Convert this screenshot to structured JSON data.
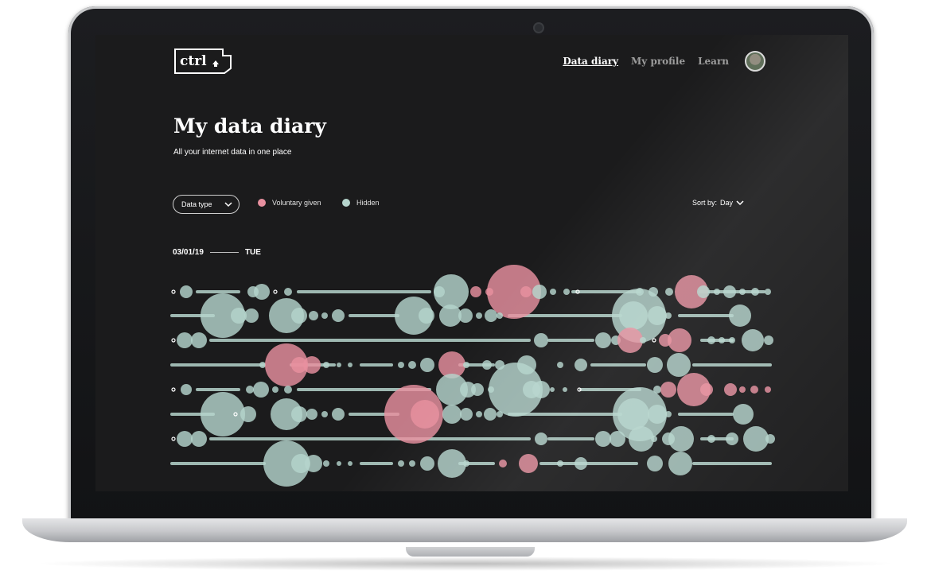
{
  "app": {
    "logo_text": "ctrl",
    "nav": [
      {
        "label": "Data diary",
        "active": true
      },
      {
        "label": "My profile",
        "active": false
      },
      {
        "label": "Learn",
        "active": false
      }
    ]
  },
  "page": {
    "title": "My data diary",
    "subtitle": "All your internet data in one place"
  },
  "filters": {
    "data_type_label": "Data type",
    "legend": [
      {
        "label": "Voluntary given",
        "color": "#e8909f"
      },
      {
        "label": "Hidden",
        "color": "#b5d4cc"
      }
    ],
    "sort_label": "Sort by:",
    "sort_value": "Day"
  },
  "date": {
    "date": "03/01/19",
    "weekday": "TUE"
  },
  "colors": {
    "voluntary": "#e8909f",
    "hidden": "#b5d4cc",
    "background": "#1b1b1c"
  },
  "icons": {
    "dropdown": "chevron-down-icon",
    "avatar": "user-avatar",
    "logo": "upload-arrow-icon"
  }
}
